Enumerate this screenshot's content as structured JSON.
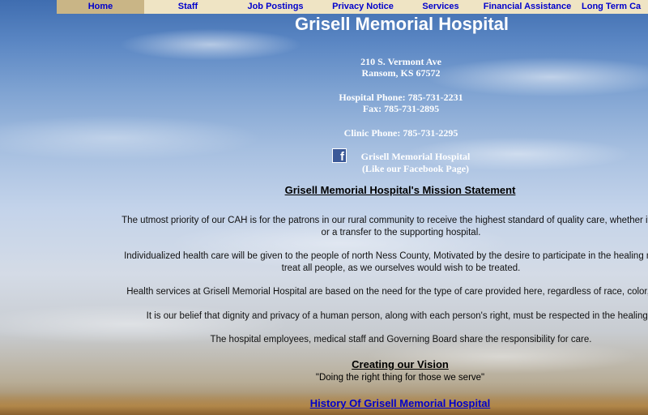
{
  "nav": {
    "items": [
      {
        "label": "Home"
      },
      {
        "label": "Staff"
      },
      {
        "label": "Job Postings"
      },
      {
        "label": "Privacy Notice"
      },
      {
        "label": "Services"
      },
      {
        "label": "Financial Assistance"
      },
      {
        "label": "Long Term Ca"
      }
    ]
  },
  "header": {
    "title": "Grisell Memorial Hospital",
    "address_line1": "210 S. Vermont Ave",
    "address_line2": "Ransom, KS 67572",
    "hospital_phone": "Hospital Phone: 785-731-2231",
    "fax": "Fax: 785-731-2895",
    "clinic_phone": "Clinic Phone: 785-731-2295"
  },
  "facebook": {
    "icon_glyph": "f",
    "name": "Grisell Memorial Hospital",
    "cta": "(Like our Facebook Page)"
  },
  "mission": {
    "heading": "Grisell Memorial Hospital's Mission Statement",
    "paragraphs": [
      {
        "line1": "The utmost priority of our CAH is for the patrons in our rural community to receive the highest standard of quality care, whether it is an a",
        "line2": "or a transfer to the supporting hospital."
      },
      {
        "line1": "Individualized health care will be given to the people of north Ness County, Motivated by the desire to participate in the healing mission",
        "line2": "treat all people, as we ourselves would wish to be treated."
      },
      {
        "line1": "Health services at Grisell Memorial Hospital are based on the need for the type of care provided here, regardless of race, color, creed"
      },
      {
        "line1": "It is our belief that dignity and privacy of a human person, along with each person's right, must be respected in the healing p"
      },
      {
        "line1": "The hospital employees, medical staff and Governing Board share the responsibility for care."
      }
    ]
  },
  "vision": {
    "heading": "Creating our Vision",
    "quote": "\"Doing the right thing for those we serve\""
  },
  "history": {
    "link": "History Of Grisell Memorial Hospital"
  },
  "colors": {
    "nav_background": "#efe4c4",
    "nav_active": "#c9b586",
    "link": "#0000cc",
    "header_text": "#ffffff"
  }
}
